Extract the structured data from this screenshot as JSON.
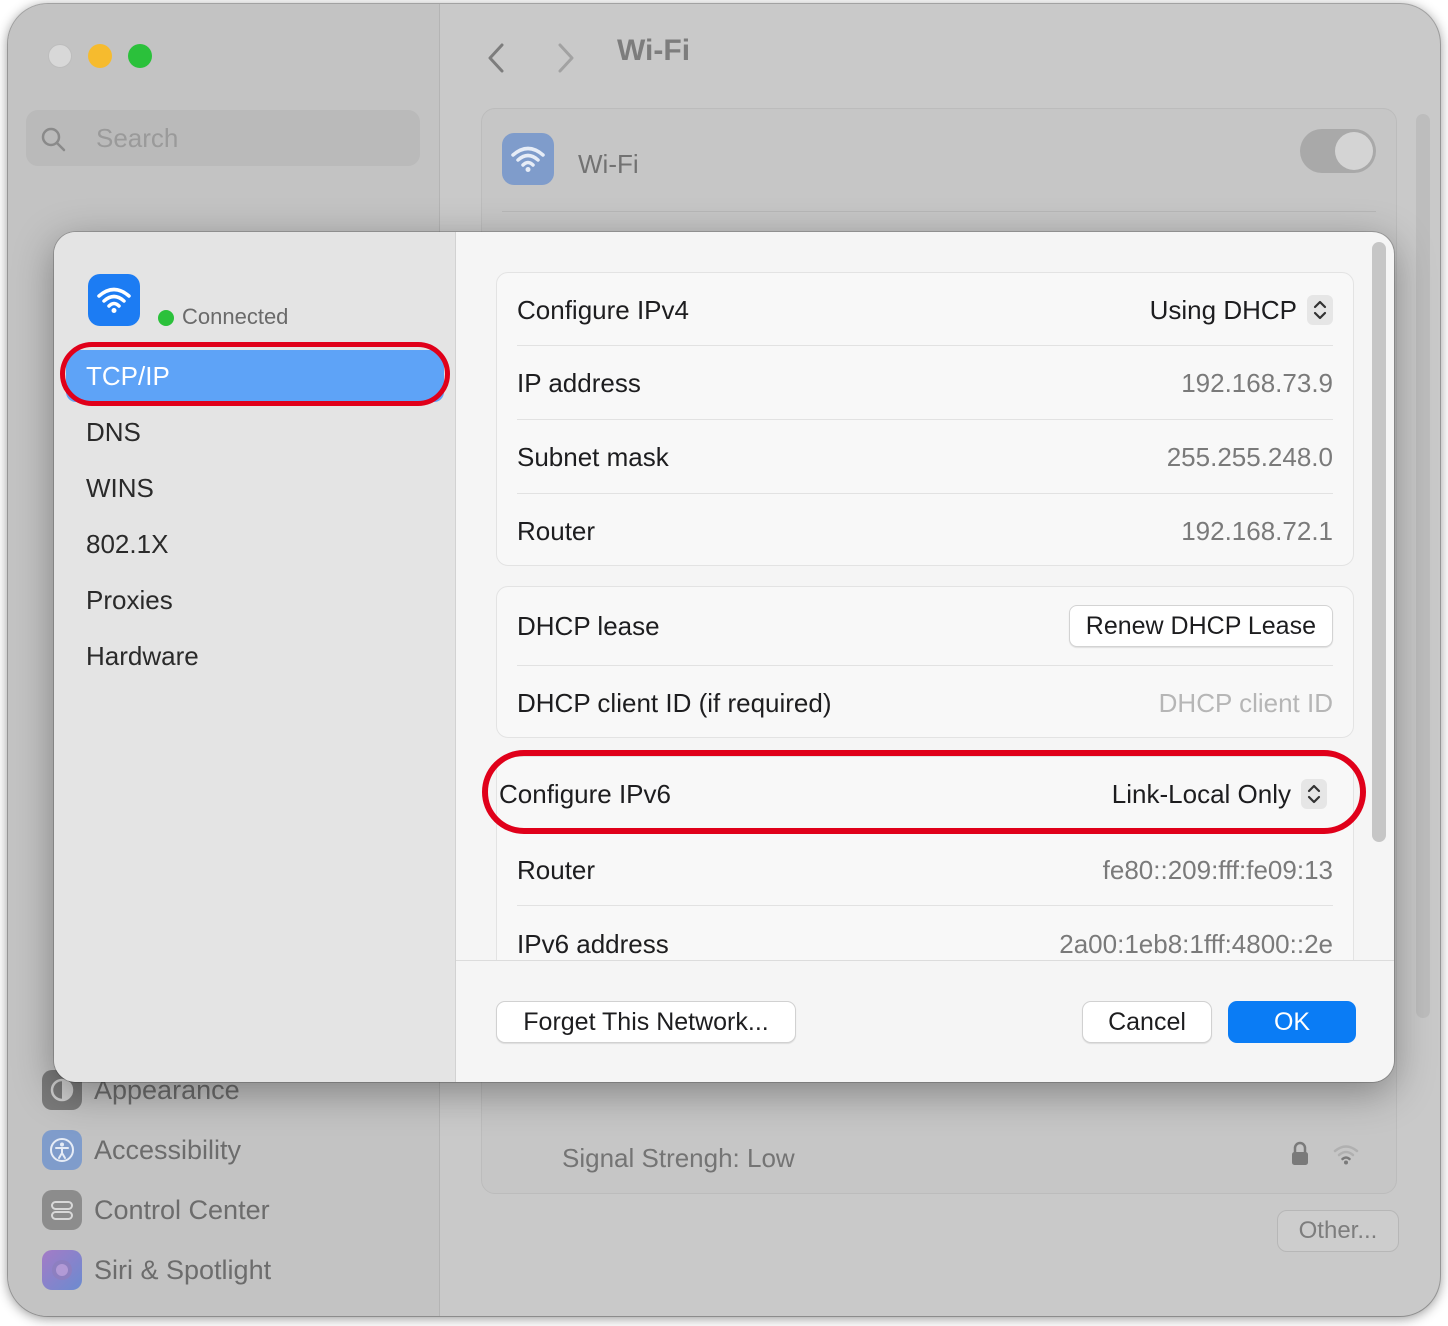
{
  "window": {
    "title": "Wi-Fi",
    "search": {
      "placeholder": "Search"
    },
    "sidebar_items": [
      {
        "label": "Appearance",
        "icon": "appearance-icon"
      },
      {
        "label": "Accessibility",
        "icon": "accessibility-icon"
      },
      {
        "label": "Control Center",
        "icon": "control-center-icon"
      },
      {
        "label": "Siri & Spotlight",
        "icon": "siri-icon"
      }
    ],
    "wifi_toggle_label": "Wi-Fi",
    "network_row": "Signal Strengh: Low",
    "other_button": "Other..."
  },
  "sheet": {
    "status": "Connected",
    "tabs": [
      "TCP/IP",
      "DNS",
      "WINS",
      "802.1X",
      "Proxies",
      "Hardware"
    ],
    "active_tab": "TCP/IP",
    "ipv4": {
      "configure_label": "Configure IPv4",
      "configure_value": "Using DHCP",
      "ip_label": "IP address",
      "ip_value": "192.168.73.9",
      "subnet_label": "Subnet mask",
      "subnet_value": "255.255.248.0",
      "router_label": "Router",
      "router_value": "192.168.72.1"
    },
    "dhcp": {
      "lease_label": "DHCP lease",
      "renew_button": "Renew DHCP Lease",
      "client_id_label": "DHCP client ID (if required)",
      "client_id_placeholder": "DHCP client ID"
    },
    "ipv6": {
      "configure_label": "Configure IPv6",
      "configure_value": "Link-Local Only",
      "router_label": "Router",
      "router_value": "fe80::209:fff:fe09:13",
      "address_label": "IPv6 address",
      "address_value": "2a00:1eb8:1fff:4800::2e"
    },
    "footer": {
      "forget_button": "Forget This Network...",
      "cancel_button": "Cancel",
      "ok_button": "OK"
    }
  },
  "colors": {
    "accent": "#0a7cf5",
    "highlight": "#e0001a",
    "connected": "#2bc13b"
  }
}
